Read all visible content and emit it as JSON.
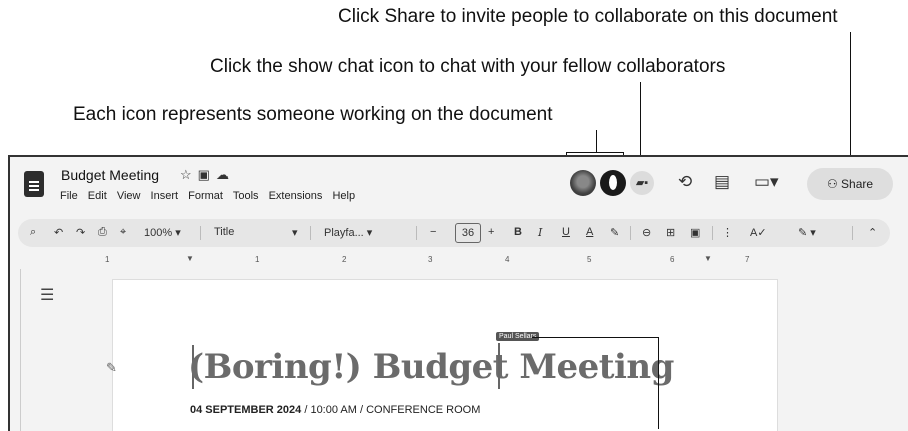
{
  "callouts": {
    "share": "Click Share to invite people to collaborate on this document",
    "chat": "Click the show chat icon to chat with your fellow collaborators",
    "avatars": "Each icon represents someone working on the document"
  },
  "titlebar": {
    "title": "Budget Meeting",
    "menu": [
      "File",
      "Edit",
      "View",
      "Insert",
      "Format",
      "Tools",
      "Extensions",
      "Help"
    ],
    "share_label": "Share",
    "icons": [
      "star-icon",
      "folder-icon",
      "cloud-icon",
      "avatar-1",
      "avatar-2",
      "show-chat-icon",
      "history-icon",
      "comment-icon",
      "meet-icon",
      "share-people-icon"
    ]
  },
  "toolbar": {
    "zoom": "100%",
    "style": "Title",
    "font": "Playfa...",
    "font_size": "36",
    "bold": "B",
    "italic": "I",
    "underline": "U",
    "text_color": "A"
  },
  "ruler": [
    "1",
    "1",
    "2",
    "3",
    "4",
    "5",
    "6",
    "7"
  ],
  "document": {
    "heading": "(Boring!) Budget Meeting",
    "cursor_user": "Paul Sellars",
    "subline_bold": "04 SEPTEMBER 2024",
    "subline_rest": " / 10:00 AM / CONFERENCE ROOM"
  }
}
